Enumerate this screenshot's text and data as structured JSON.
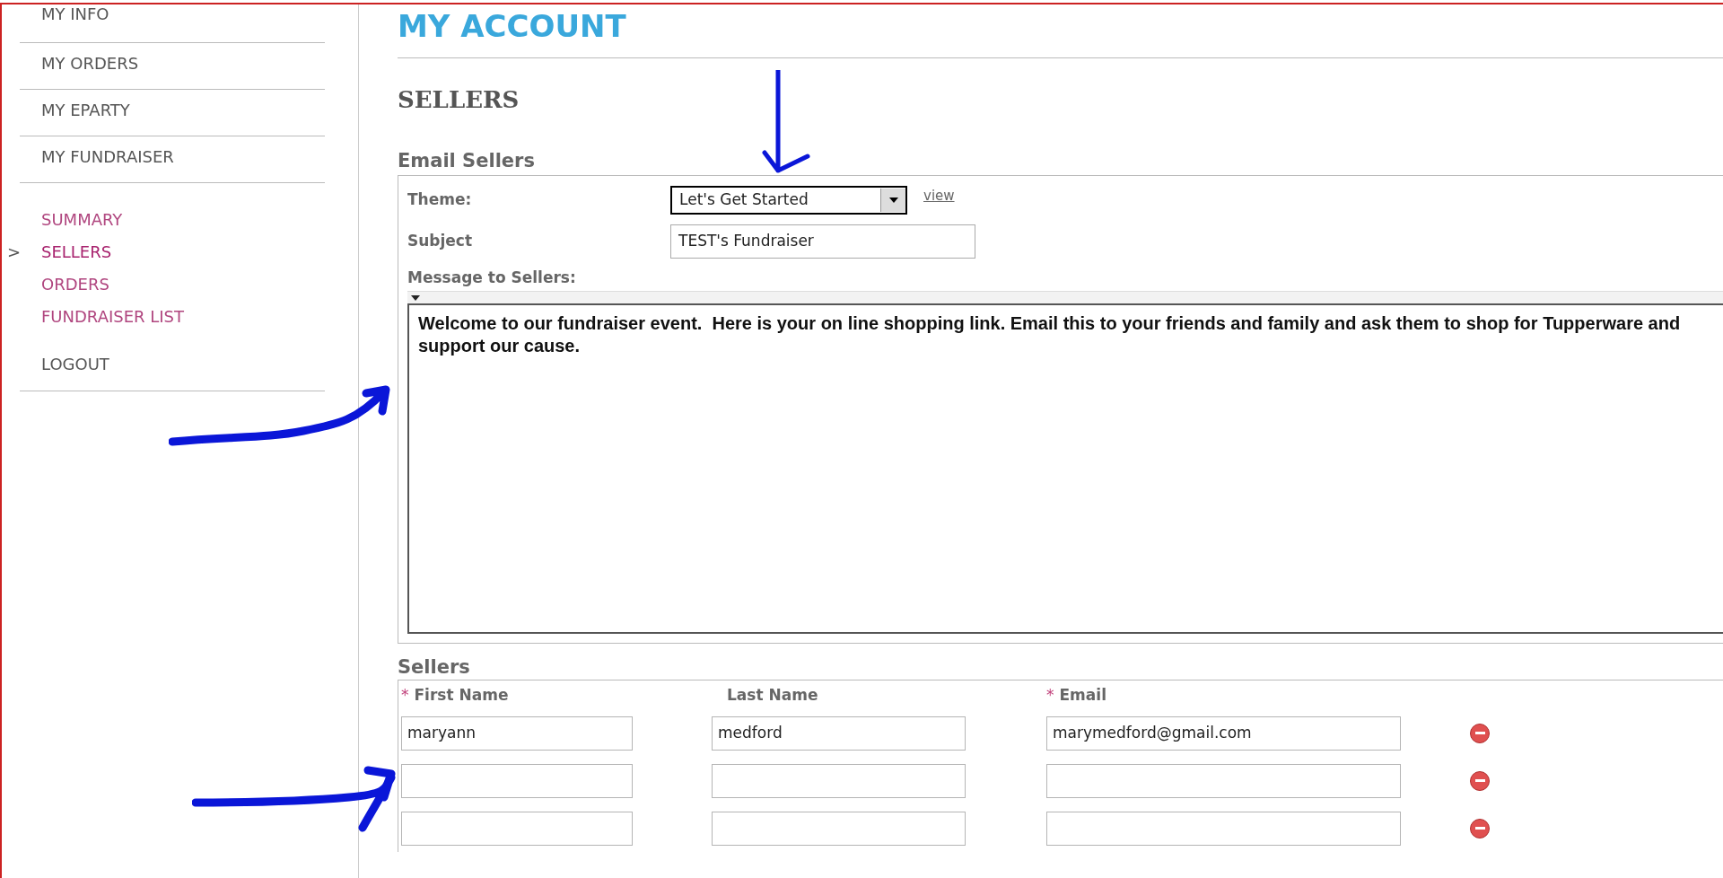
{
  "page": {
    "title": "MY ACCOUNT"
  },
  "sidebar": {
    "items": [
      {
        "label": "MY INFO"
      },
      {
        "label": "MY ORDERS"
      },
      {
        "label": "MY EPARTY"
      },
      {
        "label": "MY FUNDRAISER"
      }
    ],
    "current_marker": ">",
    "sub_items": [
      {
        "label": "SUMMARY",
        "selected": false
      },
      {
        "label": "SELLERS",
        "selected": true
      },
      {
        "label": "ORDERS",
        "selected": false
      },
      {
        "label": "FUNDRAISER LIST",
        "selected": false
      }
    ],
    "logout": "LOGOUT"
  },
  "section_title": "SELLERS",
  "email_form": {
    "title": "Email Sellers",
    "theme": {
      "label": "Theme:",
      "value": "Let's Get Started",
      "link": "view"
    },
    "subject": {
      "label": "Subject",
      "value": "TEST's Fundraiser"
    },
    "message": {
      "label": "Message to Sellers:",
      "value": "Welcome to our fundraiser event.  Here is your on line shopping link. Email this to your friends and family and ask them to shop for Tupperware and support our cause."
    }
  },
  "sellers": {
    "title": "Sellers",
    "required_mark": "*",
    "columns": [
      {
        "label": "First Name",
        "required": true
      },
      {
        "label": "Last Name",
        "required": false
      },
      {
        "label": "Email",
        "required": true
      }
    ],
    "rows": [
      {
        "first_name": "maryann",
        "last_name": "medford",
        "email": "marymedford@gmail.com"
      },
      {},
      {}
    ]
  }
}
